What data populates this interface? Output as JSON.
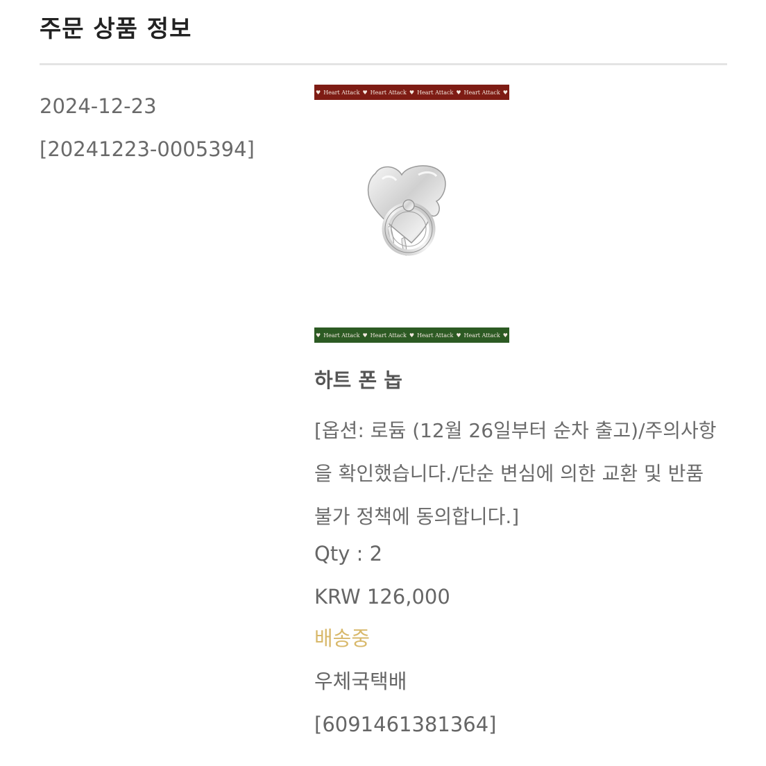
{
  "section": {
    "title": "주문 상품 정보"
  },
  "order": {
    "date": "2024-12-23",
    "number": "[20241223-0005394]"
  },
  "product": {
    "image_banner_text": "Heart Attack",
    "image_banner_colors": {
      "top": "#7e1c14",
      "bottom": "#2c5a23"
    },
    "image_icon": "heart-phone-grip-image",
    "name": "하트 폰 놉",
    "option": "[옵션: 로듐 (12월 26일부터 순차 출고)/주의사항을 확인했습니다./단순 변심에 의한 교환 및 반품 불가 정책에 동의합니다.]",
    "qty": "Qty : 2",
    "price": "KRW 126,000"
  },
  "shipping": {
    "status": "배송중",
    "status_color": "#d8b86a",
    "carrier": "우체국택배",
    "tracking": "[6091461381364]"
  }
}
